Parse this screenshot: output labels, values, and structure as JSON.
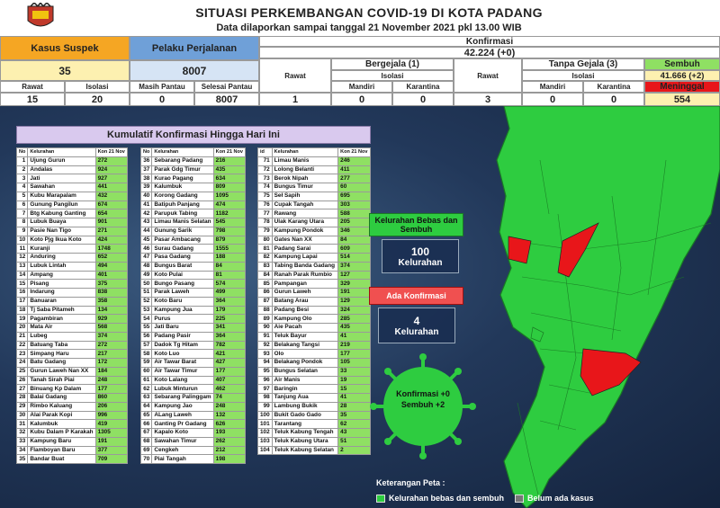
{
  "header": {
    "title": "SITUASI PERKEMBANGAN COVID-19 DI KOTA PADANG",
    "subtitle": "Data dilaporkan sampai tanggal 21 November 2021 pkl 13.00 WIB"
  },
  "colors": {
    "green": "#8fe063",
    "suspect_orange": "#f5a623",
    "traveler_blue": "#6fa0d8",
    "yellow": "#fdf0b0",
    "red": "#e8161a",
    "map_green": "#2ecc40"
  },
  "stats": {
    "kasus_suspek": {
      "label": "Kasus Suspek",
      "value": "35",
      "rawat_label": "Rawat",
      "rawat": "15",
      "isolasi_label": "Isolasi",
      "isolasi": "20"
    },
    "pelaku_perjalanan": {
      "label": "Pelaku Perjalanan",
      "value": "8007",
      "masih_pantau_label": "Masih Pantau",
      "masih_pantau": "0",
      "selesai_pantau_label": "Selesai Pantau",
      "selesai_pantau": "8007"
    },
    "konfirmasi": {
      "label": "Konfirmasi",
      "value": "42.224 (+0)",
      "bergejala": {
        "label": "Bergejala (1)",
        "rawat_label": "Rawat",
        "rawat": "1",
        "isolasi_label": "Isolasi",
        "mandiri_label": "Mandiri",
        "mandiri": "0",
        "karantina_label": "Karantina",
        "karantina": "0"
      },
      "tanpa_gejala": {
        "label": "Tanpa Gejala (3)",
        "rawat_label": "Rawat",
        "rawat": "3",
        "isolasi_label": "Isolasi",
        "mandiri_label": "Mandiri",
        "mandiri": "0",
        "karantina_label": "Karantina",
        "karantina": "0"
      },
      "sembuh": {
        "label": "Sembuh",
        "value": "41.666 (+2)"
      },
      "meninggal": {
        "label": "Meninggal",
        "value": "554"
      }
    }
  },
  "panel": {
    "title": "Kumulatif Konfirmasi Hingga Hari Ini",
    "col_label": "Kelurahan",
    "col_value": "Kon 21 Nov",
    "col_id": "id"
  },
  "info": {
    "bebas": {
      "label": "Kelurahan Bebas dan Sembuh",
      "value": "100",
      "unit": "Kelurahan"
    },
    "ada": {
      "label": "Ada Konfirmasi",
      "value": "4",
      "unit": "Kelurahan"
    },
    "bubble": {
      "line1": "Konfirmasi +0",
      "line2": "Sembuh +2"
    }
  },
  "legend": {
    "title": "Keterangan Peta :",
    "item1": "Kelurahan bebas dan sembuh",
    "item2": "Belum ada kasus"
  },
  "chart_data": {
    "type": "table",
    "title": "Kumulatif Konfirmasi Hingga Hari Ini",
    "columns": [
      "No",
      "Kelurahan",
      "Kon 21 Nov"
    ],
    "rows": [
      [
        "1",
        "Ujung Gurun",
        "272"
      ],
      [
        "2",
        "Andalas",
        "924"
      ],
      [
        "3",
        "Jati",
        "927"
      ],
      [
        "4",
        "Sawahan",
        "441"
      ],
      [
        "5",
        "Kubu Marapalam",
        "432"
      ],
      [
        "6",
        "Gunung Pangilun",
        "674"
      ],
      [
        "7",
        "Btg Kabung Ganting",
        "654"
      ],
      [
        "8",
        "Lubuk Buaya",
        "901"
      ],
      [
        "9",
        "Pasie Nan Tigo",
        "271"
      ],
      [
        "10",
        "Koto Pjg Ikua Koto",
        "424"
      ],
      [
        "11",
        "Kuranji",
        "1748"
      ],
      [
        "12",
        "Anduring",
        "652"
      ],
      [
        "13",
        "Lubuk Lintah",
        "494"
      ],
      [
        "14",
        "Ampang",
        "401"
      ],
      [
        "15",
        "Pisang",
        "375"
      ],
      [
        "16",
        "Indarung",
        "838"
      ],
      [
        "17",
        "Banuaran",
        "358"
      ],
      [
        "18",
        "Tj Saba Pitameh",
        "134"
      ],
      [
        "19",
        "Pagambiran",
        "929"
      ],
      [
        "20",
        "Mata Air",
        "568"
      ],
      [
        "21",
        "Lubeg",
        "374"
      ],
      [
        "22",
        "Batuang Taba",
        "272"
      ],
      [
        "23",
        "Simpang Haru",
        "217"
      ],
      [
        "24",
        "Batu Gadang",
        "172"
      ],
      [
        "25",
        "Gurun Laweh Nan XX",
        "184"
      ],
      [
        "26",
        "Tanah Sirah Piai",
        "248"
      ],
      [
        "27",
        "Binuang Kp Dalam",
        "177"
      ],
      [
        "28",
        "Balai Gadang",
        "860"
      ],
      [
        "29",
        "Rimbo Kaluang",
        "206"
      ],
      [
        "30",
        "Alai Parak Kopi",
        "996"
      ],
      [
        "31",
        "Kalumbuk",
        "419"
      ],
      [
        "32",
        "Kubu Dalam P Karakah",
        "1305"
      ],
      [
        "33",
        "Kampung Baru",
        "191"
      ],
      [
        "34",
        "Flamboyan Baru",
        "377"
      ],
      [
        "35",
        "Bandar Buat",
        "709"
      ],
      [
        "36",
        "Sebarang Padang",
        "216"
      ],
      [
        "37",
        "Parak Gdg Timur",
        "435"
      ],
      [
        "38",
        "Kurao Pagang",
        "634"
      ],
      [
        "39",
        "Kalumbuk",
        "809"
      ],
      [
        "40",
        "Korong Gadang",
        "1095"
      ],
      [
        "41",
        "Batipuh Panjang",
        "474"
      ],
      [
        "42",
        "Parupuk Tabing",
        "1182"
      ],
      [
        "43",
        "Limau Manis Selatan",
        "545"
      ],
      [
        "44",
        "Gunung Sarik",
        "798"
      ],
      [
        "45",
        "Pasar Ambacang",
        "879"
      ],
      [
        "46",
        "Surau Gadang",
        "1555"
      ],
      [
        "47",
        "Pasa Gadang",
        "188"
      ],
      [
        "48",
        "Bungus Barat",
        "84"
      ],
      [
        "49",
        "Koto Pulai",
        "81"
      ],
      [
        "50",
        "Bungo Pasang",
        "574"
      ],
      [
        "51",
        "Parak Laweh",
        "499"
      ],
      [
        "52",
        "Koto Baru",
        "364"
      ],
      [
        "53",
        "Kampung Jua",
        "179"
      ],
      [
        "54",
        "Purus",
        "225"
      ],
      [
        "55",
        "Jati Baru",
        "341"
      ],
      [
        "56",
        "Padang Pasir",
        "364"
      ],
      [
        "57",
        "Dadok Tg Hitam",
        "782"
      ],
      [
        "58",
        "Koto Luo",
        "421"
      ],
      [
        "59",
        "Air Tawar Barat",
        "427"
      ],
      [
        "60",
        "Air Tawar Timur",
        "177"
      ],
      [
        "61",
        "Koto Lalang",
        "407"
      ],
      [
        "62",
        "Lubuk Minturun",
        "462"
      ],
      [
        "63",
        "Sebarang Palinggam",
        "74"
      ],
      [
        "64",
        "Kampung Jao",
        "248"
      ],
      [
        "65",
        "ALang Laweh",
        "132"
      ],
      [
        "66",
        "Ganting Pr Gadang",
        "626"
      ],
      [
        "67",
        "Kapalo Koto",
        "193"
      ],
      [
        "68",
        "Sawahan Timur",
        "262"
      ],
      [
        "69",
        "Cengkeh",
        "212"
      ],
      [
        "70",
        "Piai Tangah",
        "198"
      ],
      [
        "71",
        "Limau Manis",
        "246"
      ],
      [
        "72",
        "Lolong Belanti",
        "411"
      ],
      [
        "73",
        "Berok Nipah",
        "277"
      ],
      [
        "74",
        "Bungus Timur",
        "60"
      ],
      [
        "75",
        "Seł Sapih",
        "695"
      ],
      [
        "76",
        "Cupak Tangah",
        "303"
      ],
      [
        "77",
        "Rawang",
        "588"
      ],
      [
        "78",
        "Ulak Karang Utara",
        "205"
      ],
      [
        "79",
        "Kampung Pondok",
        "346"
      ],
      [
        "80",
        "Gates Nan XX",
        "84"
      ],
      [
        "81",
        "Padang Sarai",
        "609"
      ],
      [
        "82",
        "Kampung Lapai",
        "514"
      ],
      [
        "83",
        "Tabing Banda Gadang",
        "374"
      ],
      [
        "84",
        "Ranah Parak Rumbio",
        "127"
      ],
      [
        "85",
        "Pampangan",
        "329"
      ],
      [
        "86",
        "Gurun Laweh",
        "191"
      ],
      [
        "87",
        "Batang Arau",
        "129"
      ],
      [
        "88",
        "Padang Besi",
        "324"
      ],
      [
        "89",
        "Kampung Olo",
        "285"
      ],
      [
        "90",
        "Aie Pacah",
        "435"
      ],
      [
        "91",
        "Teluk Bayur",
        "41"
      ],
      [
        "92",
        "Belakang Tangsi",
        "219"
      ],
      [
        "93",
        "Olo",
        "177"
      ],
      [
        "94",
        "Belakang Pondok",
        "105"
      ],
      [
        "95",
        "Bungus Selatan",
        "33"
      ],
      [
        "96",
        "Air Manis",
        "19"
      ],
      [
        "97",
        "Baringin",
        "15"
      ],
      [
        "98",
        "Tanjung Aua",
        "41"
      ],
      [
        "99",
        "Lambung Bukik",
        "28"
      ],
      [
        "100",
        "Bukit Gado Gado",
        "35"
      ],
      [
        "101",
        "Tarantang",
        "62"
      ],
      [
        "102",
        "Teluk Kabung Tengah",
        "43"
      ],
      [
        "103",
        "Teluk Kabung Utara",
        "51"
      ],
      [
        "104",
        "Teluk Kabung Selatan",
        "2"
      ]
    ]
  }
}
